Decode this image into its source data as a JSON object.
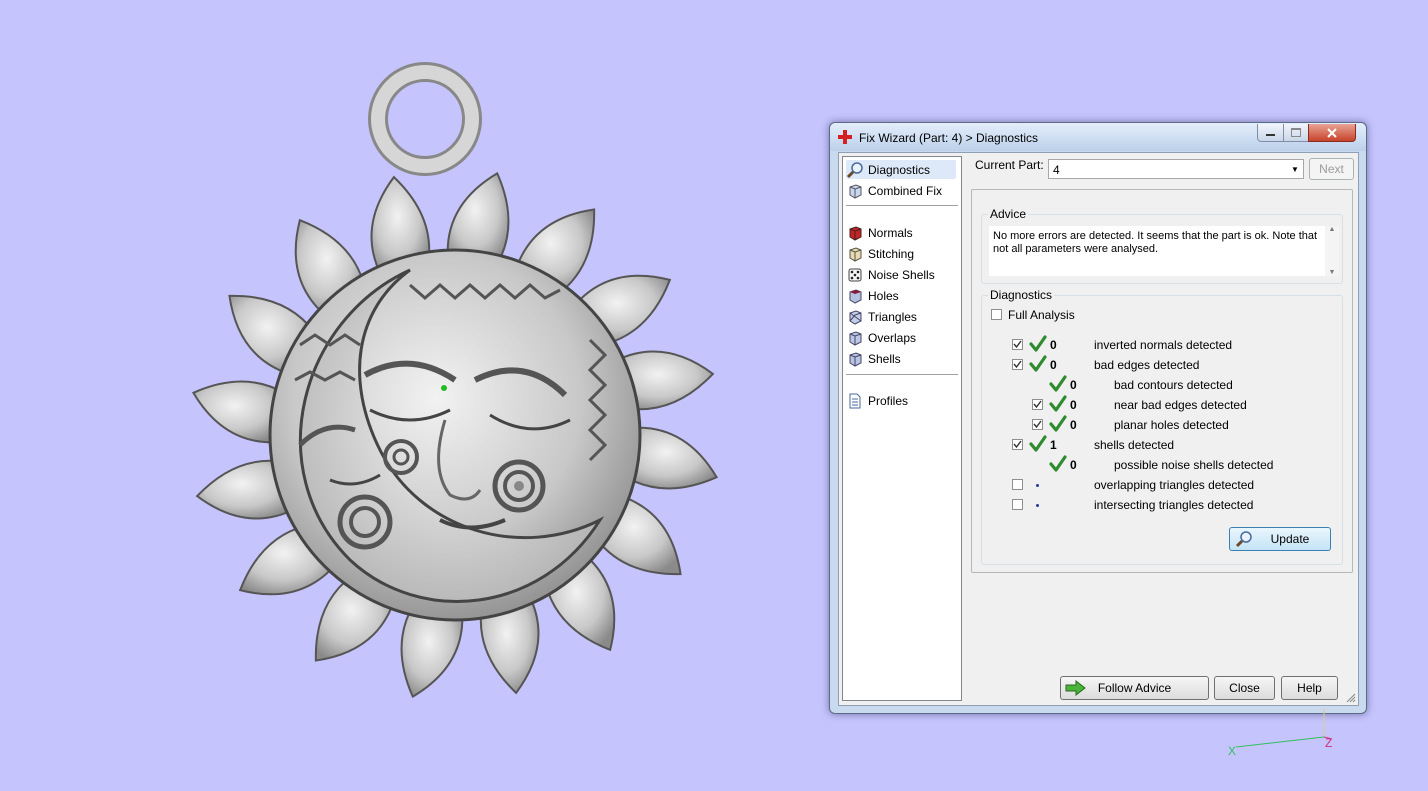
{
  "window": {
    "title": "Fix Wizard (Part: 4) > Diagnostics",
    "buttons": [
      "minimize",
      "maximize",
      "close"
    ]
  },
  "nav": {
    "items": [
      {
        "label": "Diagnostics",
        "icon": "magnifier-icon",
        "selected": true
      },
      {
        "label": "Combined Fix",
        "icon": "cube-icon"
      },
      {
        "label": "Normals",
        "icon": "cube-red-icon"
      },
      {
        "label": "Stitching",
        "icon": "cube-stitch-icon"
      },
      {
        "label": "Noise Shells",
        "icon": "dice-icon"
      },
      {
        "label": "Holes",
        "icon": "cube-hole-icon"
      },
      {
        "label": "Triangles",
        "icon": "cube-triangles-icon"
      },
      {
        "label": "Overlaps",
        "icon": "cube-overlap-icon"
      },
      {
        "label": "Shells",
        "icon": "cube-shells-icon"
      },
      {
        "label": "Profiles",
        "icon": "document-icon"
      }
    ]
  },
  "current_part": {
    "label": "Current Part:",
    "value": "4",
    "next_label": "Next"
  },
  "advice": {
    "title": "Advice",
    "text": "No more errors are detected. It seems that the part is ok. Note that not all parameters were analysed."
  },
  "diagnostics": {
    "title": "Diagnostics",
    "full_analysis_label": "Full Analysis",
    "full_analysis_checked": false,
    "rows": [
      {
        "checkbox": true,
        "checked": true,
        "ok": true,
        "count": "0",
        "label": "inverted normals detected",
        "indent": 0
      },
      {
        "checkbox": true,
        "checked": true,
        "ok": true,
        "count": "0",
        "label": "bad edges detected",
        "indent": 0
      },
      {
        "checkbox": false,
        "checked": false,
        "ok": true,
        "count": "0",
        "label": "bad contours detected",
        "indent": 1
      },
      {
        "checkbox": true,
        "checked": true,
        "ok": true,
        "count": "0",
        "label": "near bad edges detected",
        "indent": 1
      },
      {
        "checkbox": true,
        "checked": true,
        "ok": true,
        "count": "0",
        "label": "planar holes detected",
        "indent": 1
      },
      {
        "checkbox": true,
        "checked": true,
        "ok": true,
        "count": "1",
        "label": "shells detected",
        "indent": 0
      },
      {
        "checkbox": false,
        "checked": false,
        "ok": true,
        "count": "0",
        "label": "possible noise shells detected",
        "indent": 1
      },
      {
        "checkbox": true,
        "checked": false,
        "ok": false,
        "count": "",
        "label": "overlapping triangles detected",
        "indent": 0
      },
      {
        "checkbox": true,
        "checked": false,
        "ok": false,
        "count": "",
        "label": "intersecting triangles detected",
        "indent": 0
      }
    ],
    "update_label": "Update"
  },
  "footer": {
    "follow_advice_label": "Follow Advice",
    "close_label": "Close",
    "help_label": "Help"
  },
  "axis": {
    "x_label": "X",
    "z_label": "Z"
  },
  "colors": {
    "background": "#c6c4fd",
    "ok_check": "#2e8b2e",
    "title_bar": "#c9d9ee"
  }
}
